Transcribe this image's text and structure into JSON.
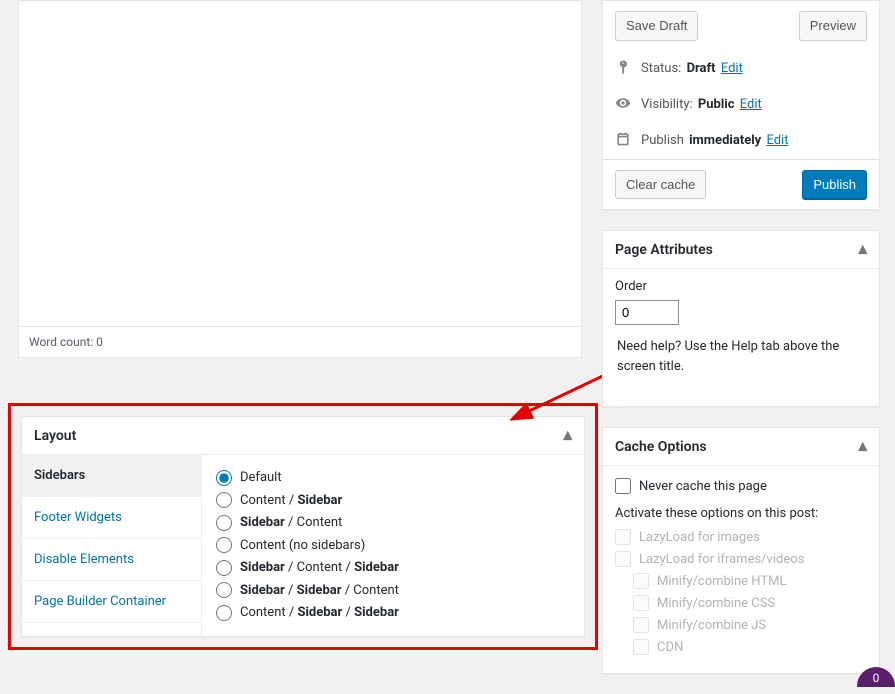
{
  "editor": {
    "word_count_label": "Word count: 0"
  },
  "publish": {
    "save_draft": "Save Draft",
    "preview": "Preview",
    "status_label": "Status:",
    "status_value": "Draft",
    "status_edit": "Edit",
    "visibility_label": "Visibility:",
    "visibility_value": "Public",
    "visibility_edit": "Edit",
    "schedule_label": "Publish",
    "schedule_value": "immediately",
    "schedule_edit": "Edit",
    "clear_cache": "Clear cache",
    "publish_button": "Publish"
  },
  "page_attributes": {
    "title": "Page Attributes",
    "order_label": "Order",
    "order_value": "0",
    "help_text": "Need help? Use the Help tab above the screen title."
  },
  "cache": {
    "title": "Cache Options",
    "never_cache": "Never cache this page",
    "activate_label": "Activate these options on this post:",
    "options": [
      "LazyLoad for images",
      "LazyLoad for iframes/videos",
      "Minify/combine HTML",
      "Minify/combine CSS",
      "Minify/combine JS",
      "CDN"
    ]
  },
  "layout": {
    "title": "Layout",
    "tabs": [
      "Sidebars",
      "Footer Widgets",
      "Disable Elements",
      "Page Builder Container"
    ],
    "options": [
      {
        "raw": "Default",
        "parts": [
          "Default"
        ]
      },
      {
        "raw": "Content / Sidebar",
        "parts": [
          "Content / ",
          "Sidebar"
        ]
      },
      {
        "raw": "Sidebar / Content",
        "parts": [
          "Sidebar",
          " / Content"
        ]
      },
      {
        "raw": "Content (no sidebars)",
        "parts": [
          "Content (no sidebars)"
        ]
      },
      {
        "raw": "Sidebar / Content / Sidebar",
        "parts": [
          "Sidebar",
          " / Content / ",
          "Sidebar"
        ]
      },
      {
        "raw": "Sidebar / Sidebar / Content",
        "parts": [
          "Sidebar",
          " / ",
          "Sidebar",
          " / Content"
        ]
      },
      {
        "raw": "Content / Sidebar / Sidebar",
        "parts": [
          "Content / ",
          "Sidebar",
          " / ",
          "Sidebar"
        ]
      }
    ],
    "selected": 0
  },
  "badge": {
    "value": "0"
  }
}
